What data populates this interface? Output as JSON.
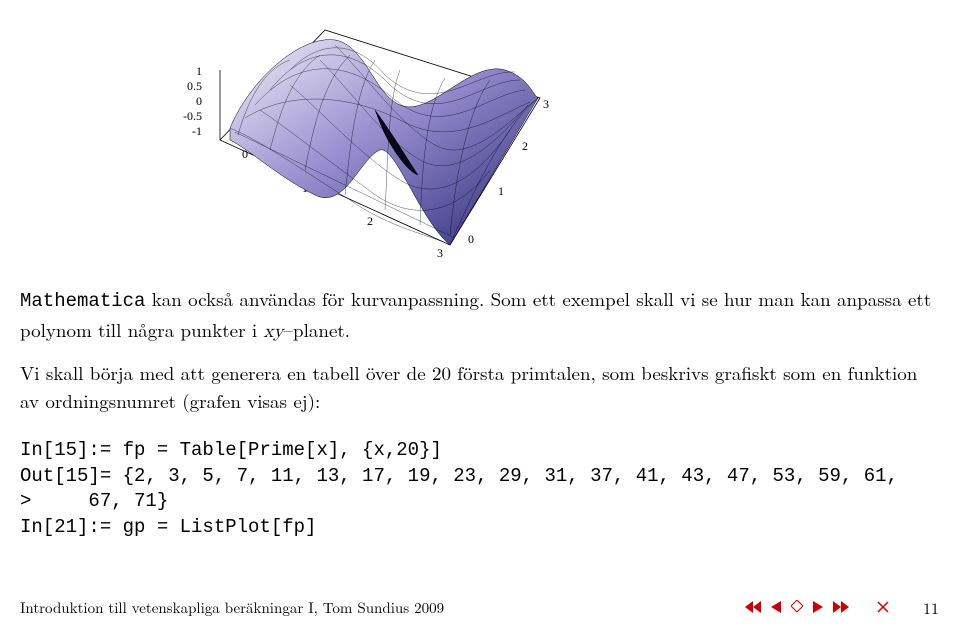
{
  "chart_data": {
    "type": "surface3d",
    "title": "",
    "x_range": [
      0,
      3
    ],
    "y_range": [
      0,
      3
    ],
    "z_range": [
      -1,
      1
    ],
    "x_ticks": [
      0,
      1,
      2,
      3
    ],
    "y_ticks": [
      0,
      1,
      2,
      3
    ],
    "z_ticks": [
      -1,
      -0.5,
      0,
      0.5,
      1
    ],
    "description": "3D surface plot with two peaks and a trough, rendered with wireframe mesh and blue-purple-white gradient shading"
  },
  "para1": {
    "lead_tt": "Mathematica",
    "rest": " kan också användas för kurvanpassning. Som ett exempel skall vi se hur man kan anpassa ett polynom till några punkter i ",
    "math": "xy",
    "tail": "–planet."
  },
  "para2": "Vi skall börja med att generera en tabell över de 20 första primtalen, som beskrivs grafiskt som en funktion av ordningsnumret (grafen visas ej):",
  "code": {
    "line1": "In[15]:= fp = Table[Prime[x], {x,20}]",
    "line2": "Out[15]= {2, 3, 5, 7, 11, 13, 17, 19, 23, 29, 31, 37, 41, 43, 47, 53, 59, 61,",
    "line3": ">     67, 71}",
    "line4": "In[21]:= gp = ListPlot[fp]"
  },
  "footer": {
    "left": "Introduktion till vetenskapliga beräkningar I, Tom Sundius 2009",
    "page": "11"
  },
  "z_labels": {
    "z1": "1",
    "z05": "0.5",
    "z0": "0",
    "zm05": "-0.5",
    "zm1": "-1"
  },
  "x_labels": {
    "x0": "0",
    "x1": "1",
    "x2": "2",
    "x3": "3"
  },
  "y_labels": {
    "y0": "0",
    "y1": "1",
    "y2": "2",
    "y3": "3"
  }
}
